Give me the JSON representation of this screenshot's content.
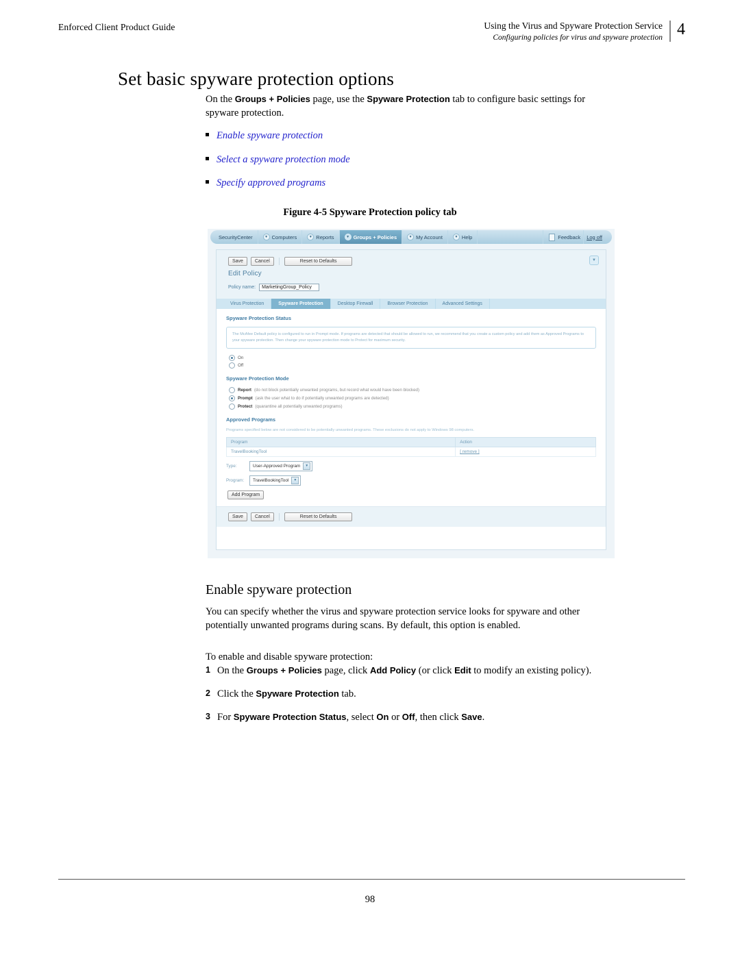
{
  "header": {
    "left": "Enforced Client Product Guide",
    "right_line1": "Using the Virus and Spyware Protection Service",
    "right_line2": "Configuring policies for virus and spyware protection",
    "chapter_number": "4"
  },
  "section": {
    "title": "Set basic spyware protection options",
    "intro_p1": "On the ",
    "intro_b1": "Groups + Policies",
    "intro_p2": " page, use the ",
    "intro_b2": "Spyware Protection",
    "intro_p3": " tab to configure basic settings for spyware protection.",
    "links": [
      "Enable spyware protection",
      "Select a spyware protection mode",
      "Specify approved programs"
    ]
  },
  "figure": {
    "caption": "Figure 4-5  Spyware Protection policy tab",
    "navbar": {
      "brand": "SecurityCenter",
      "items": [
        {
          "label": "Computers",
          "active": false
        },
        {
          "label": "Reports",
          "active": false
        },
        {
          "label": "Groups + Policies",
          "active": true
        },
        {
          "label": "My Account",
          "active": false
        },
        {
          "label": "Help",
          "active": false
        }
      ],
      "feedback": "Feedback",
      "logoff": "Log off"
    },
    "toolbar": {
      "save": "Save",
      "cancel": "Cancel",
      "reset": "Reset to Defaults"
    },
    "edit_policy_title": "Edit Policy",
    "policy_name_label": "Policy name:",
    "policy_name_value": "MarketingGroup_Policy",
    "tabs": [
      {
        "label": "Virus Protection",
        "active": false
      },
      {
        "label": "Spyware Protection",
        "active": true
      },
      {
        "label": "Desktop Firewall",
        "active": false
      },
      {
        "label": "Browser Protection",
        "active": false
      },
      {
        "label": "Advanced Settings",
        "active": false
      }
    ],
    "status_section_title": "Spyware Protection Status",
    "info_text": "The McAfee Default policy is configured to run in Prompt mode. If programs are detected that should be allowed to run, we recommend that you create a custom policy and add them as Approved Programs to your spyware protection. Then change your spyware protection mode to Protect for maximum security.",
    "status_options": [
      {
        "label": "On",
        "selected": true
      },
      {
        "label": "Off",
        "selected": false
      }
    ],
    "mode_section_title": "Spyware Protection Mode",
    "mode_options": [
      {
        "label": "Report",
        "desc": "(do not block potentially unwanted programs, but record what would have been blocked)",
        "selected": false
      },
      {
        "label": "Prompt",
        "desc": "(ask the user what to do if potentially unwanted programs are detected)",
        "selected": true
      },
      {
        "label": "Protect",
        "desc": "(quarantine all potentially unwanted programs)",
        "selected": false
      }
    ],
    "approved_section_title": "Approved Programs",
    "approved_desc": "Programs specified below are not considered to be potentially unwanted programs. These exclusions do not apply to Windows 98 computers.",
    "table": {
      "headers": [
        "Program",
        "Action"
      ],
      "rows": [
        {
          "program": "TravelBookingTool",
          "action": "[ remove ]"
        }
      ]
    },
    "form": {
      "type_label": "Type:",
      "type_value": "User-Approved Program",
      "program_label": "Program:",
      "program_value": "TravelBookingTool",
      "add_button": "Add Program"
    },
    "collapse_icon": "▼"
  },
  "enable_section": {
    "title": "Enable spyware protection",
    "para1": "You can specify whether the virus and spyware protection service looks for spyware and other potentially unwanted programs during scans. By default, this option is enabled.",
    "para2": "To enable and disable spyware protection:",
    "steps": [
      {
        "num": "1",
        "parts": [
          {
            "t": "On the ",
            "b": false
          },
          {
            "t": "Groups + Policies",
            "b": true
          },
          {
            "t": " page, click ",
            "b": false
          },
          {
            "t": "Add Policy",
            "b": true
          },
          {
            "t": " (or click ",
            "b": false
          },
          {
            "t": "Edit",
            "b": true
          },
          {
            "t": " to modify an existing policy).",
            "b": false
          }
        ]
      },
      {
        "num": "2",
        "parts": [
          {
            "t": "Click the ",
            "b": false
          },
          {
            "t": "Spyware Protection",
            "b": true
          },
          {
            "t": " tab.",
            "b": false
          }
        ]
      },
      {
        "num": "3",
        "parts": [
          {
            "t": "For ",
            "b": false
          },
          {
            "t": "Spyware Protection Status",
            "b": true
          },
          {
            "t": ", select ",
            "b": false
          },
          {
            "t": "On",
            "b": true
          },
          {
            "t": " or ",
            "b": false
          },
          {
            "t": "Off",
            "b": true
          },
          {
            "t": ", then click ",
            "b": false
          },
          {
            "t": "Save",
            "b": true
          },
          {
            "t": ".",
            "b": false
          }
        ]
      }
    ]
  },
  "footer": {
    "page_number": "98"
  }
}
